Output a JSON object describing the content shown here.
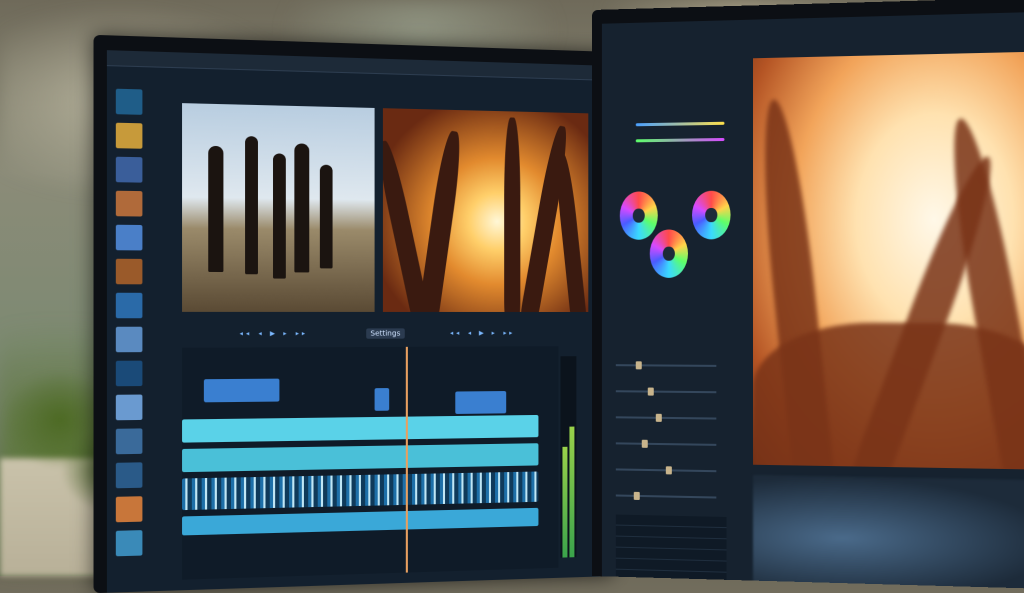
{
  "scene": {
    "description_tags": [
      "video-editing-workstation",
      "dual-monitor"
    ],
    "colors": {
      "ui_dark": "#13202e",
      "accent_blue": "#7bb8ff",
      "playhead": "#e8a060",
      "clip_cyan": "#5ad2e8",
      "clip_blue": "#3a7fd0",
      "meter_green": "#3aa34b"
    }
  },
  "left_monitor": {
    "transport_left": "◂◂ ◂ ▶ ▸ ▸▸",
    "transport_right": "◂◂ ◂ ▶ ▸ ▸▸",
    "button_label": "Settings"
  },
  "right_monitor": {
    "icons": [
      "color-wheel-icon",
      "color-wheel-icon",
      "color-wheel-icon"
    ]
  }
}
